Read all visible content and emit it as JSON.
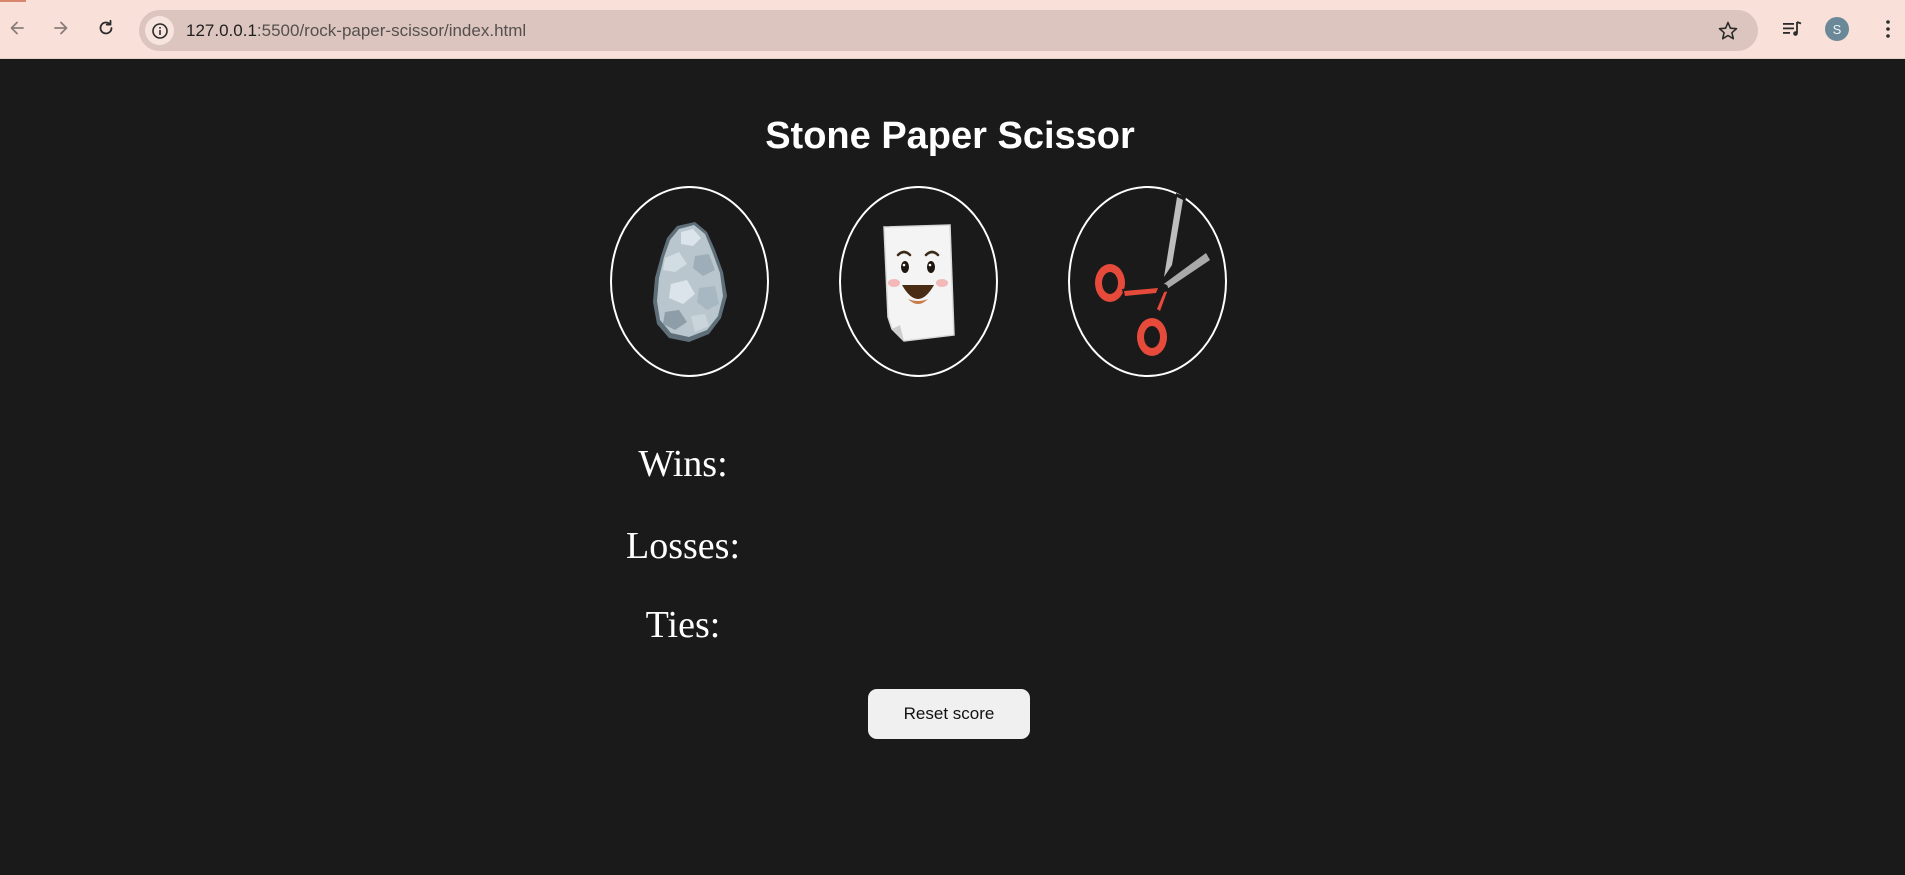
{
  "browser": {
    "url_host": "127.0.0.1",
    "url_path": ":5500/rock-paper-scissor/index.html",
    "profile_initial": "S"
  },
  "page": {
    "title": "Stone Paper Scissor",
    "moves": [
      {
        "name": "stone",
        "icon": "stone-icon"
      },
      {
        "name": "paper",
        "icon": "paper-icon"
      },
      {
        "name": "scissor",
        "icon": "scissor-icon"
      }
    ],
    "scores": {
      "wins_label": "Wins:",
      "losses_label": "Losses:",
      "ties_label": "Ties:"
    },
    "reset_label": "Reset score"
  },
  "colors": {
    "page_background": "#1b1a1b",
    "browser_bar": "#f9e1da",
    "omnibox": "#dcc5bf",
    "reset_button": "#f0f0f0",
    "scissor_handle": "#e64a3a"
  }
}
